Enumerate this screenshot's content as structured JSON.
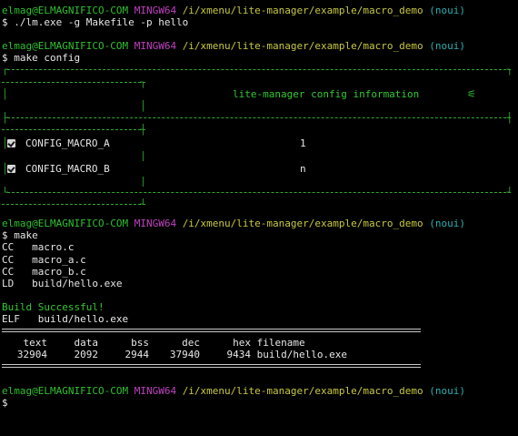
{
  "prompt": {
    "user_host": "elmag@ELMAGNIFICO-COM",
    "system": "MINGW64",
    "path": "/i/xmenu/lite-manager/example/macro_demo",
    "branch": "(noui)",
    "symbol": "$"
  },
  "commands": {
    "first": "./lm.exe -g Makefile -p hello",
    "second": "make config",
    "third": "make"
  },
  "config_box": {
    "title": "lite-manager config information",
    "title_icon": "wrench-icon",
    "title_glyph": "⚟",
    "items": [
      {
        "name": "CONFIG_MACRO_A",
        "value": "1",
        "checked": true
      },
      {
        "name": "CONFIG_MACRO_B",
        "value": "n",
        "checked": true
      }
    ]
  },
  "build_log": [
    {
      "tool": "CC",
      "file": "macro.c"
    },
    {
      "tool": "CC",
      "file": "macro_a.c"
    },
    {
      "tool": "CC",
      "file": "macro_b.c"
    },
    {
      "tool": "LD",
      "file": "build/hello.exe"
    }
  ],
  "build_status": "Build Successful!",
  "elf_line": {
    "label": "ELF",
    "file": "build/hello.exe"
  },
  "size_table": {
    "headers": [
      "text",
      "data",
      "bss",
      "dec",
      "hex",
      "filename"
    ],
    "row": [
      "32904",
      "2092",
      "2944",
      "37940",
      "9434",
      "build/hello.exe"
    ]
  },
  "colors": {
    "prompt_user": "#2fc02f",
    "prompt_system": "#c040c0",
    "prompt_path": "#c8c840",
    "prompt_branch": "#2ab0b0",
    "success": "#32c832",
    "box_border": "#2fa82f",
    "background": "#000000"
  }
}
